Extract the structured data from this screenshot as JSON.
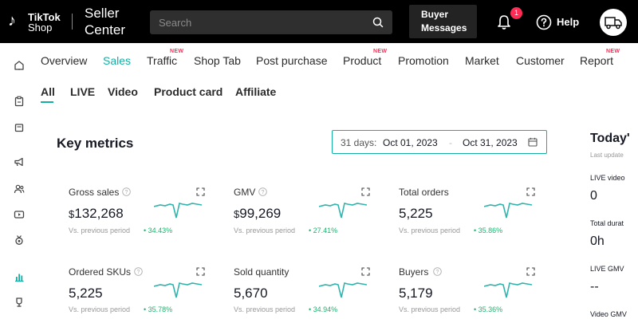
{
  "header": {
    "logo_line1": "TikTok",
    "logo_line2": "Shop",
    "seller_line1": "Seller",
    "seller_line2": "Center",
    "search_placeholder": "Search",
    "buyer_messages_line1": "Buyer",
    "buyer_messages_line2": "Messages",
    "notification_count": "1",
    "help_label": "Help"
  },
  "sidebar": {
    "icons": [
      "home-icon",
      "clipboard-icon",
      "bag-icon",
      "megaphone-icon",
      "users-icon",
      "video-icon",
      "medal-icon",
      "chart-icon",
      "trophy-icon"
    ]
  },
  "tabs": [
    {
      "label": "Overview",
      "new": ""
    },
    {
      "label": "Sales",
      "new": ""
    },
    {
      "label": "Traffic",
      "new": "NEW"
    },
    {
      "label": "Shop Tab",
      "new": ""
    },
    {
      "label": "Post purchase",
      "new": ""
    },
    {
      "label": "Product",
      "new": "NEW"
    },
    {
      "label": "Promotion",
      "new": ""
    },
    {
      "label": "Market",
      "new": ""
    },
    {
      "label": "Customer",
      "new": ""
    },
    {
      "label": "Report",
      "new": "NEW"
    }
  ],
  "subtabs": [
    "All",
    "LIVE",
    "Video",
    "Product card",
    "Affiliate"
  ],
  "key_metrics": {
    "title": "Key metrics",
    "date_prefix": "31 days:",
    "date_start": "Oct 01, 2023",
    "date_sep": "-",
    "date_end": "Oct 31, 2023",
    "vs_label": "Vs. previous period",
    "metrics": [
      {
        "label": "Gross sales",
        "currency": "$",
        "value": "132,268",
        "change": "34.43%"
      },
      {
        "label": "GMV",
        "currency": "$",
        "value": "99,269",
        "change": "27.41%"
      },
      {
        "label": "Total orders",
        "currency": "",
        "value": "5,225",
        "change": "35.86%"
      },
      {
        "label": "Ordered SKUs",
        "currency": "",
        "value": "5,225",
        "change": "35.78%"
      },
      {
        "label": "Sold quantity",
        "currency": "",
        "value": "5,670",
        "change": "34.94%"
      },
      {
        "label": "Buyers",
        "currency": "",
        "value": "5,179",
        "change": "35.36%"
      }
    ]
  },
  "today": {
    "title": "Today'",
    "last_updated": "Last update",
    "items": [
      {
        "label": "LIVE video",
        "value": "0"
      },
      {
        "label": "Total durat",
        "value": "0h"
      },
      {
        "label": "LIVE GMV",
        "value": "--"
      },
      {
        "label": "Video GMV",
        "value": ""
      }
    ]
  },
  "colors": {
    "accent": "#13aea4",
    "new_badge": "#fe2c55",
    "positive": "#1fb36f",
    "header_bg": "#000000"
  }
}
